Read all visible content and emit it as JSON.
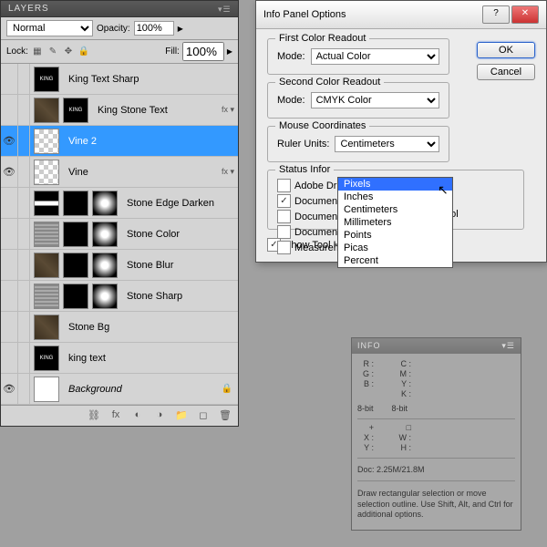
{
  "layers_panel": {
    "title": "LAYERS",
    "blend_mode": "Normal",
    "opacity_label": "Opacity:",
    "opacity_value": "100%",
    "lock_label": "Lock:",
    "fill_label": "Fill:",
    "fill_value": "100%",
    "layers": [
      {
        "name": "King Text Sharp",
        "vis": false,
        "thumbs": [
          "king"
        ],
        "fx": false,
        "active": false
      },
      {
        "name": "King Stone Text",
        "vis": false,
        "thumbs": [
          "stone",
          "king"
        ],
        "fx": true,
        "active": false
      },
      {
        "name": "Vine 2",
        "vis": true,
        "thumbs": [
          "checker"
        ],
        "fx": false,
        "active": true
      },
      {
        "name": "Vine",
        "vis": true,
        "thumbs": [
          "checker"
        ],
        "fx": true,
        "active": false
      },
      {
        "name": "Stone Edge Darken",
        "vis": false,
        "thumbs": [
          "line",
          "black",
          "gradient"
        ],
        "fx": false,
        "active": false
      },
      {
        "name": "Stone Color",
        "vis": false,
        "thumbs": [
          "pattern",
          "black",
          "gradient"
        ],
        "fx": false,
        "active": false
      },
      {
        "name": "Stone Blur",
        "vis": false,
        "thumbs": [
          "stone",
          "black",
          "gradient"
        ],
        "fx": false,
        "active": false
      },
      {
        "name": "Stone Sharp",
        "vis": false,
        "thumbs": [
          "pattern",
          "black",
          "gradient"
        ],
        "fx": false,
        "active": false
      },
      {
        "name": "Stone Bg",
        "vis": false,
        "thumbs": [
          "stone"
        ],
        "fx": false,
        "active": false
      },
      {
        "name": "king text",
        "vis": false,
        "thumbs": [
          "king"
        ],
        "fx": false,
        "active": false
      },
      {
        "name": "Background",
        "vis": true,
        "thumbs": [
          "white"
        ],
        "fx": false,
        "active": false,
        "bg": true,
        "lock": true
      }
    ]
  },
  "dialog": {
    "title": "Info Panel Options",
    "ok": "OK",
    "cancel": "Cancel",
    "first_readout": {
      "legend": "First Color Readout",
      "mode_label": "Mode:",
      "mode_value": "Actual Color"
    },
    "second_readout": {
      "legend": "Second Color Readout",
      "mode_label": "Mode:",
      "mode_value": "CMYK Color"
    },
    "mouse": {
      "legend": "Mouse Coordinates",
      "ruler_label": "Ruler Units:",
      "ruler_value": "Centimeters"
    },
    "ruler_options": [
      "Pixels",
      "Inches",
      "Centimeters",
      "Millimeters",
      "Points",
      "Picas",
      "Percent"
    ],
    "ruler_selected": "Pixels",
    "status": {
      "legend": "Status Infor",
      "items": [
        {
          "label": "Adobe Driv",
          "checked": false
        },
        {
          "label": "Document",
          "checked": true
        },
        {
          "label": "Document",
          "checked": false
        },
        {
          "label": "Document Dimensions",
          "checked": false
        },
        {
          "label": "Measurement Scale",
          "checked": false
        }
      ],
      "current_tool": {
        "label": "Current Tool",
        "checked": false
      }
    },
    "show_hints": {
      "label": "Show Tool Hints",
      "checked": true
    }
  },
  "info_panel": {
    "title": "INFO",
    "left": [
      {
        "l": "R :",
        "v": ""
      },
      {
        "l": "G :",
        "v": ""
      },
      {
        "l": "B :",
        "v": ""
      }
    ],
    "right": [
      {
        "l": "C :",
        "v": ""
      },
      {
        "l": "M :",
        "v": ""
      },
      {
        "l": "Y :",
        "v": ""
      },
      {
        "l": "K :",
        "v": ""
      }
    ],
    "bits_l": "8-bit",
    "bits_r": "8-bit",
    "xy": [
      {
        "l": "X :",
        "v": ""
      },
      {
        "l": "Y :",
        "v": ""
      }
    ],
    "wh": [
      {
        "l": "W :",
        "v": ""
      },
      {
        "l": "H :",
        "v": ""
      }
    ],
    "doc": "Doc: 2.25M/21.8M",
    "hint": "Draw rectangular selection or move selection outline.  Use Shift, Alt, and Ctrl for additional options."
  }
}
